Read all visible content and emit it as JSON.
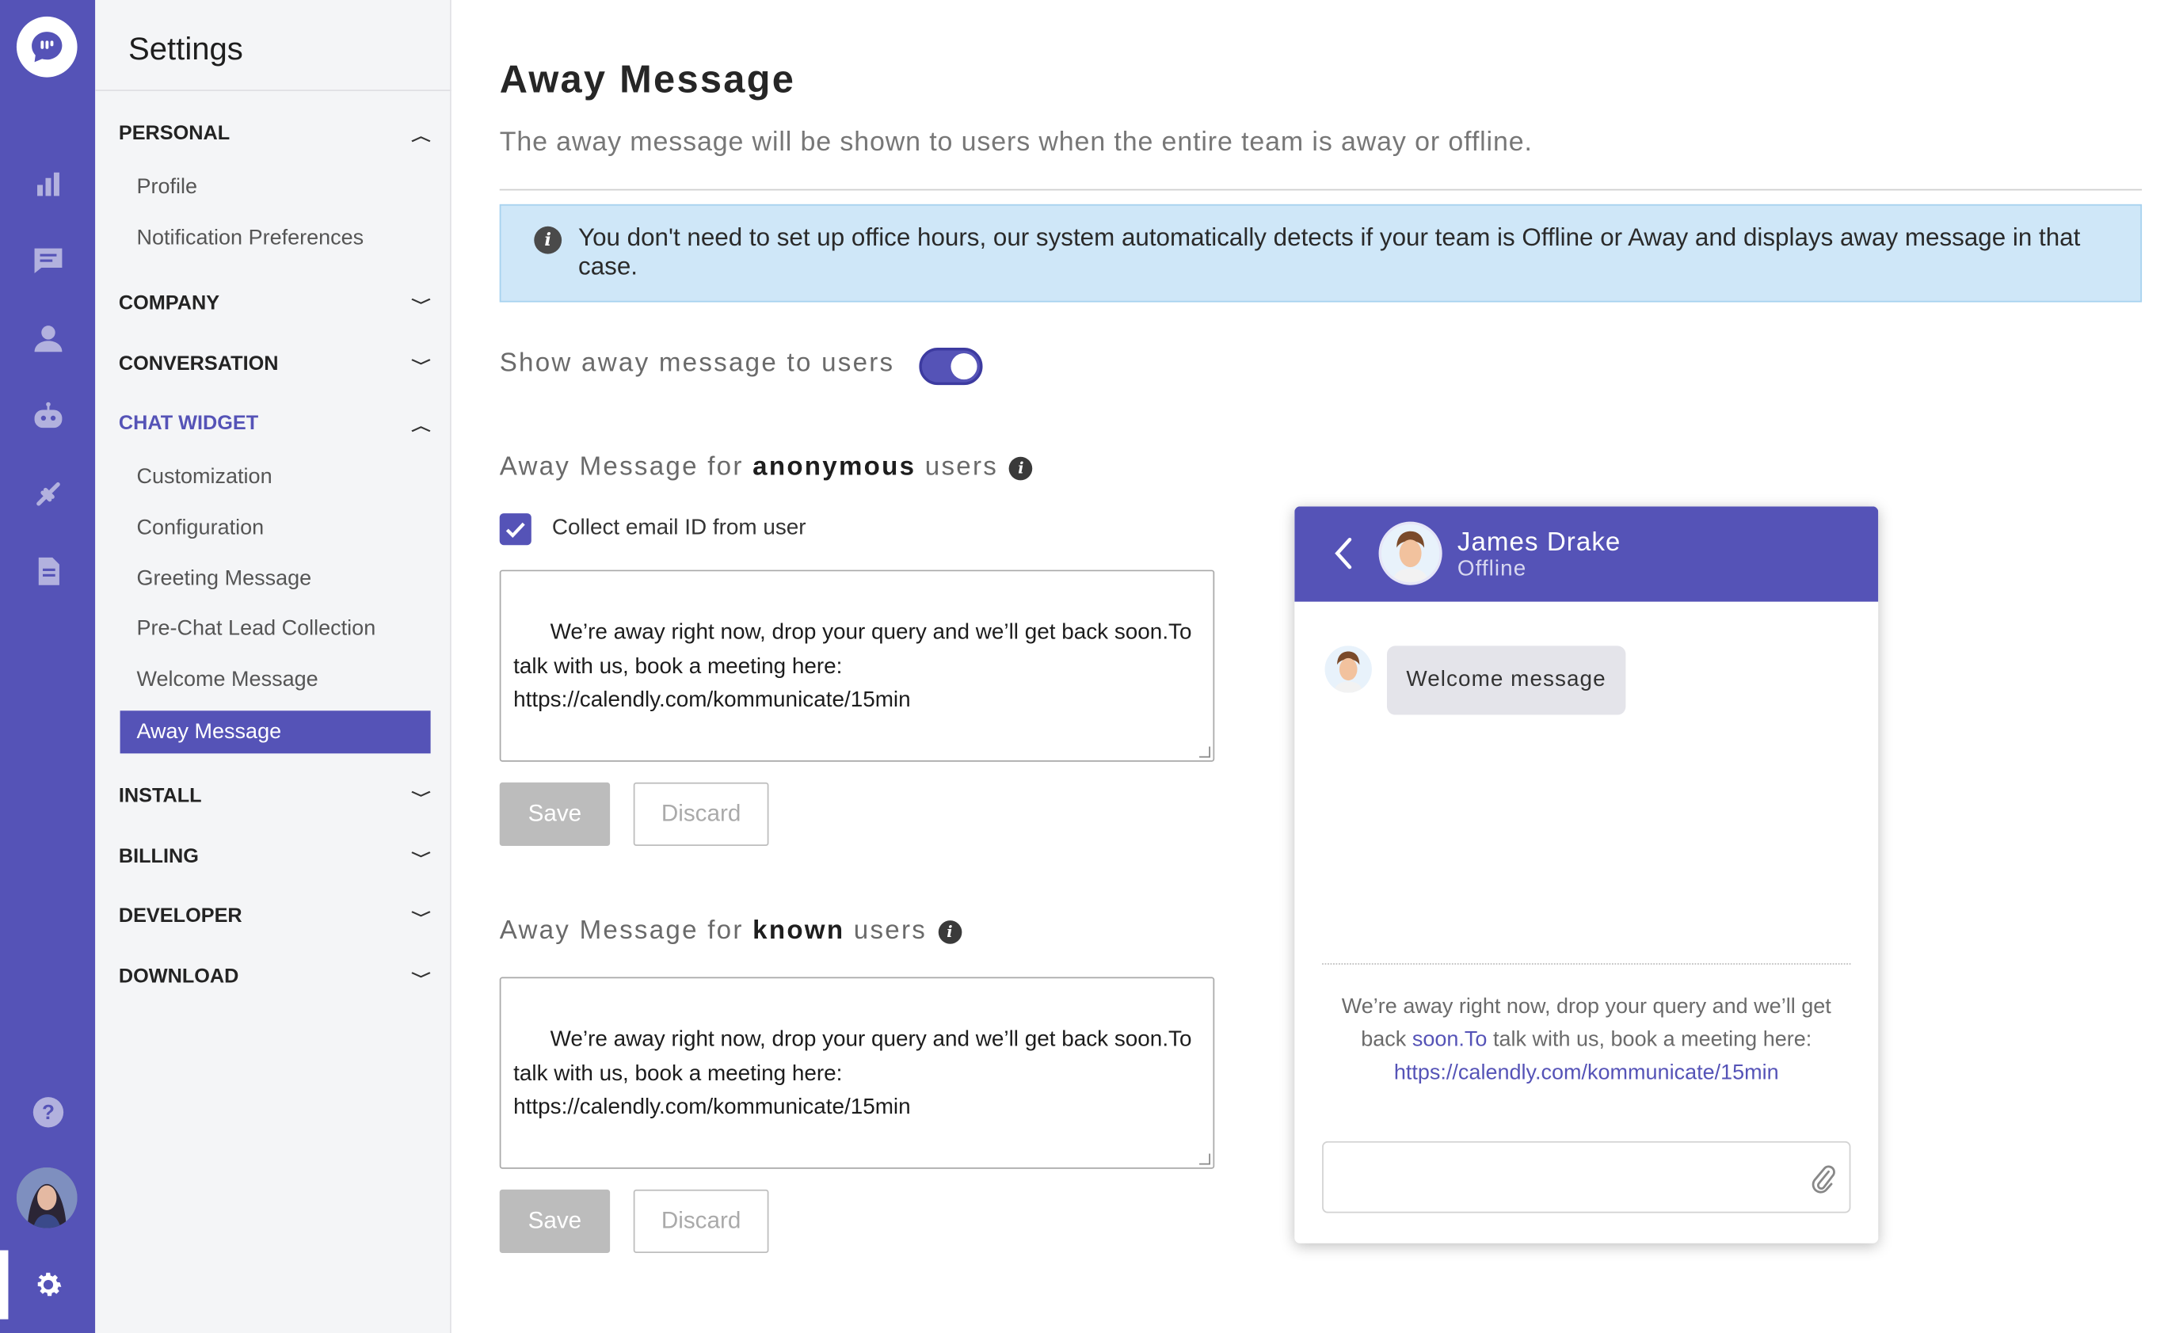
{
  "settings": {
    "title": "Settings",
    "sections": {
      "personal": "PERSONAL",
      "company": "COMPANY",
      "conversation": "CONVERSATION",
      "chat_widget": "CHAT WIDGET",
      "install": "INSTALL",
      "billing": "BILLING",
      "developer": "DEVELOPER",
      "download": "DOWNLOAD"
    },
    "personal_items": [
      "Profile",
      "Notification Preferences"
    ],
    "chat_widget_items": [
      "Customization",
      "Configuration",
      "Greeting Message",
      "Pre-Chat Lead Collection",
      "Welcome Message",
      "Away Message"
    ],
    "active_item": "Away Message"
  },
  "page": {
    "title": "Away Message",
    "description": "The away message will be shown to users when the entire team is away or offline.",
    "info": "You don't need to set up office hours, our system automatically detects if your team is Offline or Away and displays away message in that case.",
    "toggle_label": "Show away message to users",
    "toggle_on": true
  },
  "anonymous": {
    "label_prefix": "Away Message for",
    "label_bold": "anonymous",
    "label_suffix": "users",
    "collect_email_label": "Collect email ID from user",
    "collect_email_checked": true,
    "message": "We’re away right now, drop your query and we’ll get back soon.To talk with us, book a meeting here: https://calendly.com/kommunicate/15min",
    "save": "Save",
    "discard": "Discard"
  },
  "known": {
    "label_prefix": "Away Message for",
    "label_bold": "known",
    "label_suffix": "users",
    "message": "We’re away right now, drop your query and we’ll get back soon.To talk with us, book a meeting here: https://calendly.com/kommunicate/15min",
    "save": "Save",
    "discard": "Discard"
  },
  "preview": {
    "agent_name": "James Drake",
    "agent_status": "Offline",
    "welcome": "Welcome message",
    "away_line1": "We’re away right now, drop your query and we’ll get",
    "away_back": "back",
    "away_soon": "soon.To",
    "away_rest": "talk with us, book a meeting here:",
    "away_link": "https://calendly.com/kommunicate/15min"
  },
  "colors": {
    "brand": "#5553b7",
    "info_bg": "#cfe7f8",
    "save_disabled": "#bcbcbc"
  },
  "icons": [
    "chat-logo-icon",
    "analytics-icon",
    "conversations-icon",
    "users-icon",
    "bot-icon",
    "integrations-icon",
    "reports-icon",
    "help-icon",
    "settings-gear-icon"
  ]
}
